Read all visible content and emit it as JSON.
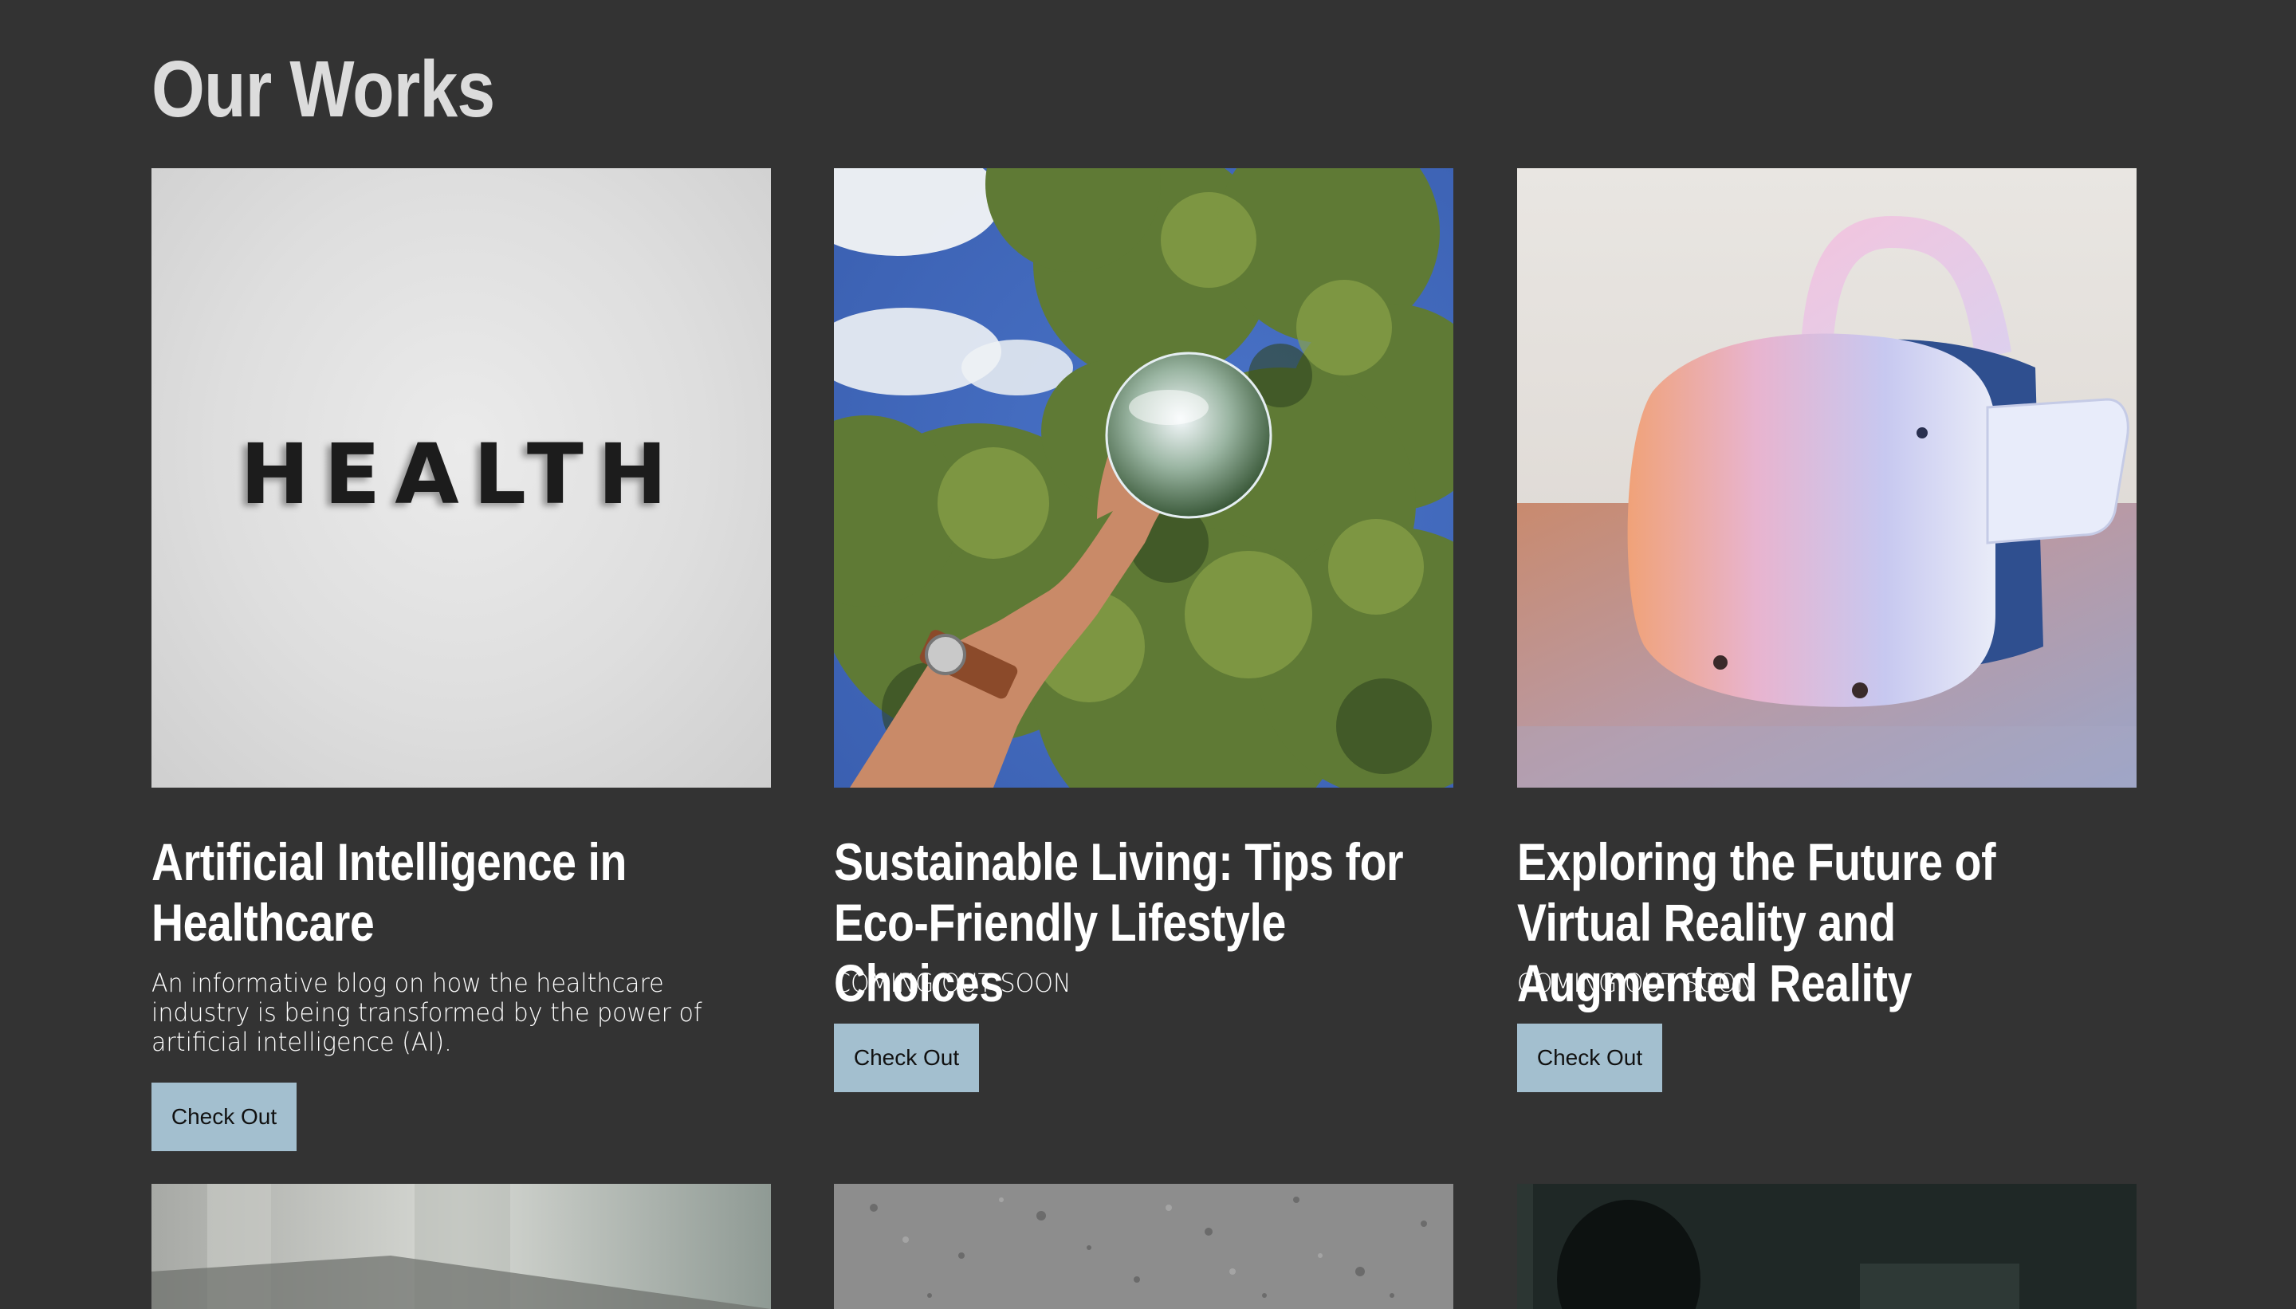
{
  "section": {
    "title": "Our Works"
  },
  "cards": [
    {
      "title": "Artificial Intelligence in Healthcare",
      "description": "An informative blog on how the healthcare industry is being transformed by the power of artificial intelligence (AI).",
      "button_label": "Check Out",
      "image_text": "HEALTH",
      "image": "health-letters-photo"
    },
    {
      "title": "Sustainable Living: Tips for Eco-Friendly Lifestyle Choices",
      "description": "COMING OUT SOON",
      "button_label": "Check Out",
      "image": "hand-holding-crystal-ball-trees-photo"
    },
    {
      "title": "Exploring the Future of Virtual Reality and Augmented Reality",
      "description": "COMING OUT SOON",
      "button_label": "Check Out",
      "image": "vr-headset-photo"
    }
  ],
  "colors": {
    "background": "#333333",
    "button": "#a3bfcf",
    "title": "#dcdcdc"
  }
}
